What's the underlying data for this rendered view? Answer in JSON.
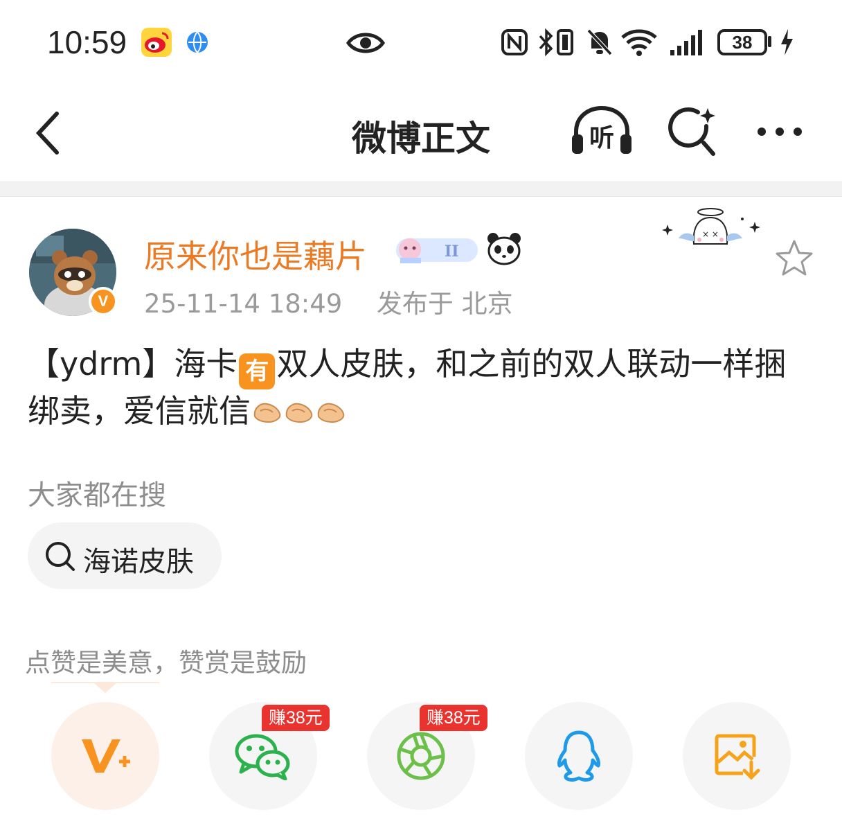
{
  "status_bar": {
    "time": "10:59",
    "battery": "38"
  },
  "nav": {
    "title": "微博正文",
    "listen_label": "听"
  },
  "post": {
    "username": "原来你也是藕片",
    "timestamp": "25-11-14 18:49",
    "location": "发布于 北京",
    "verified_badge": "V",
    "content_prefix": "【ydrm】海卡",
    "inline_badge": "有",
    "content_middle": "双人皮肤，和之前的双人联动一样捆绑卖，爱信就信",
    "colors": {
      "username": "#eb7a25",
      "accent": "#f7931e"
    }
  },
  "search": {
    "heading": "大家都在搜",
    "chip_label": "海诺皮肤"
  },
  "reward": {
    "text": "点赞是美意，赞赏是鼓励"
  },
  "share": {
    "items": [
      {
        "icon": "vplus-icon",
        "badge": ""
      },
      {
        "icon": "wechat-icon",
        "badge": "赚38元"
      },
      {
        "icon": "moments-icon",
        "badge": "赚38元"
      },
      {
        "icon": "qq-icon",
        "badge": ""
      },
      {
        "icon": "save-image-icon",
        "badge": ""
      }
    ]
  }
}
